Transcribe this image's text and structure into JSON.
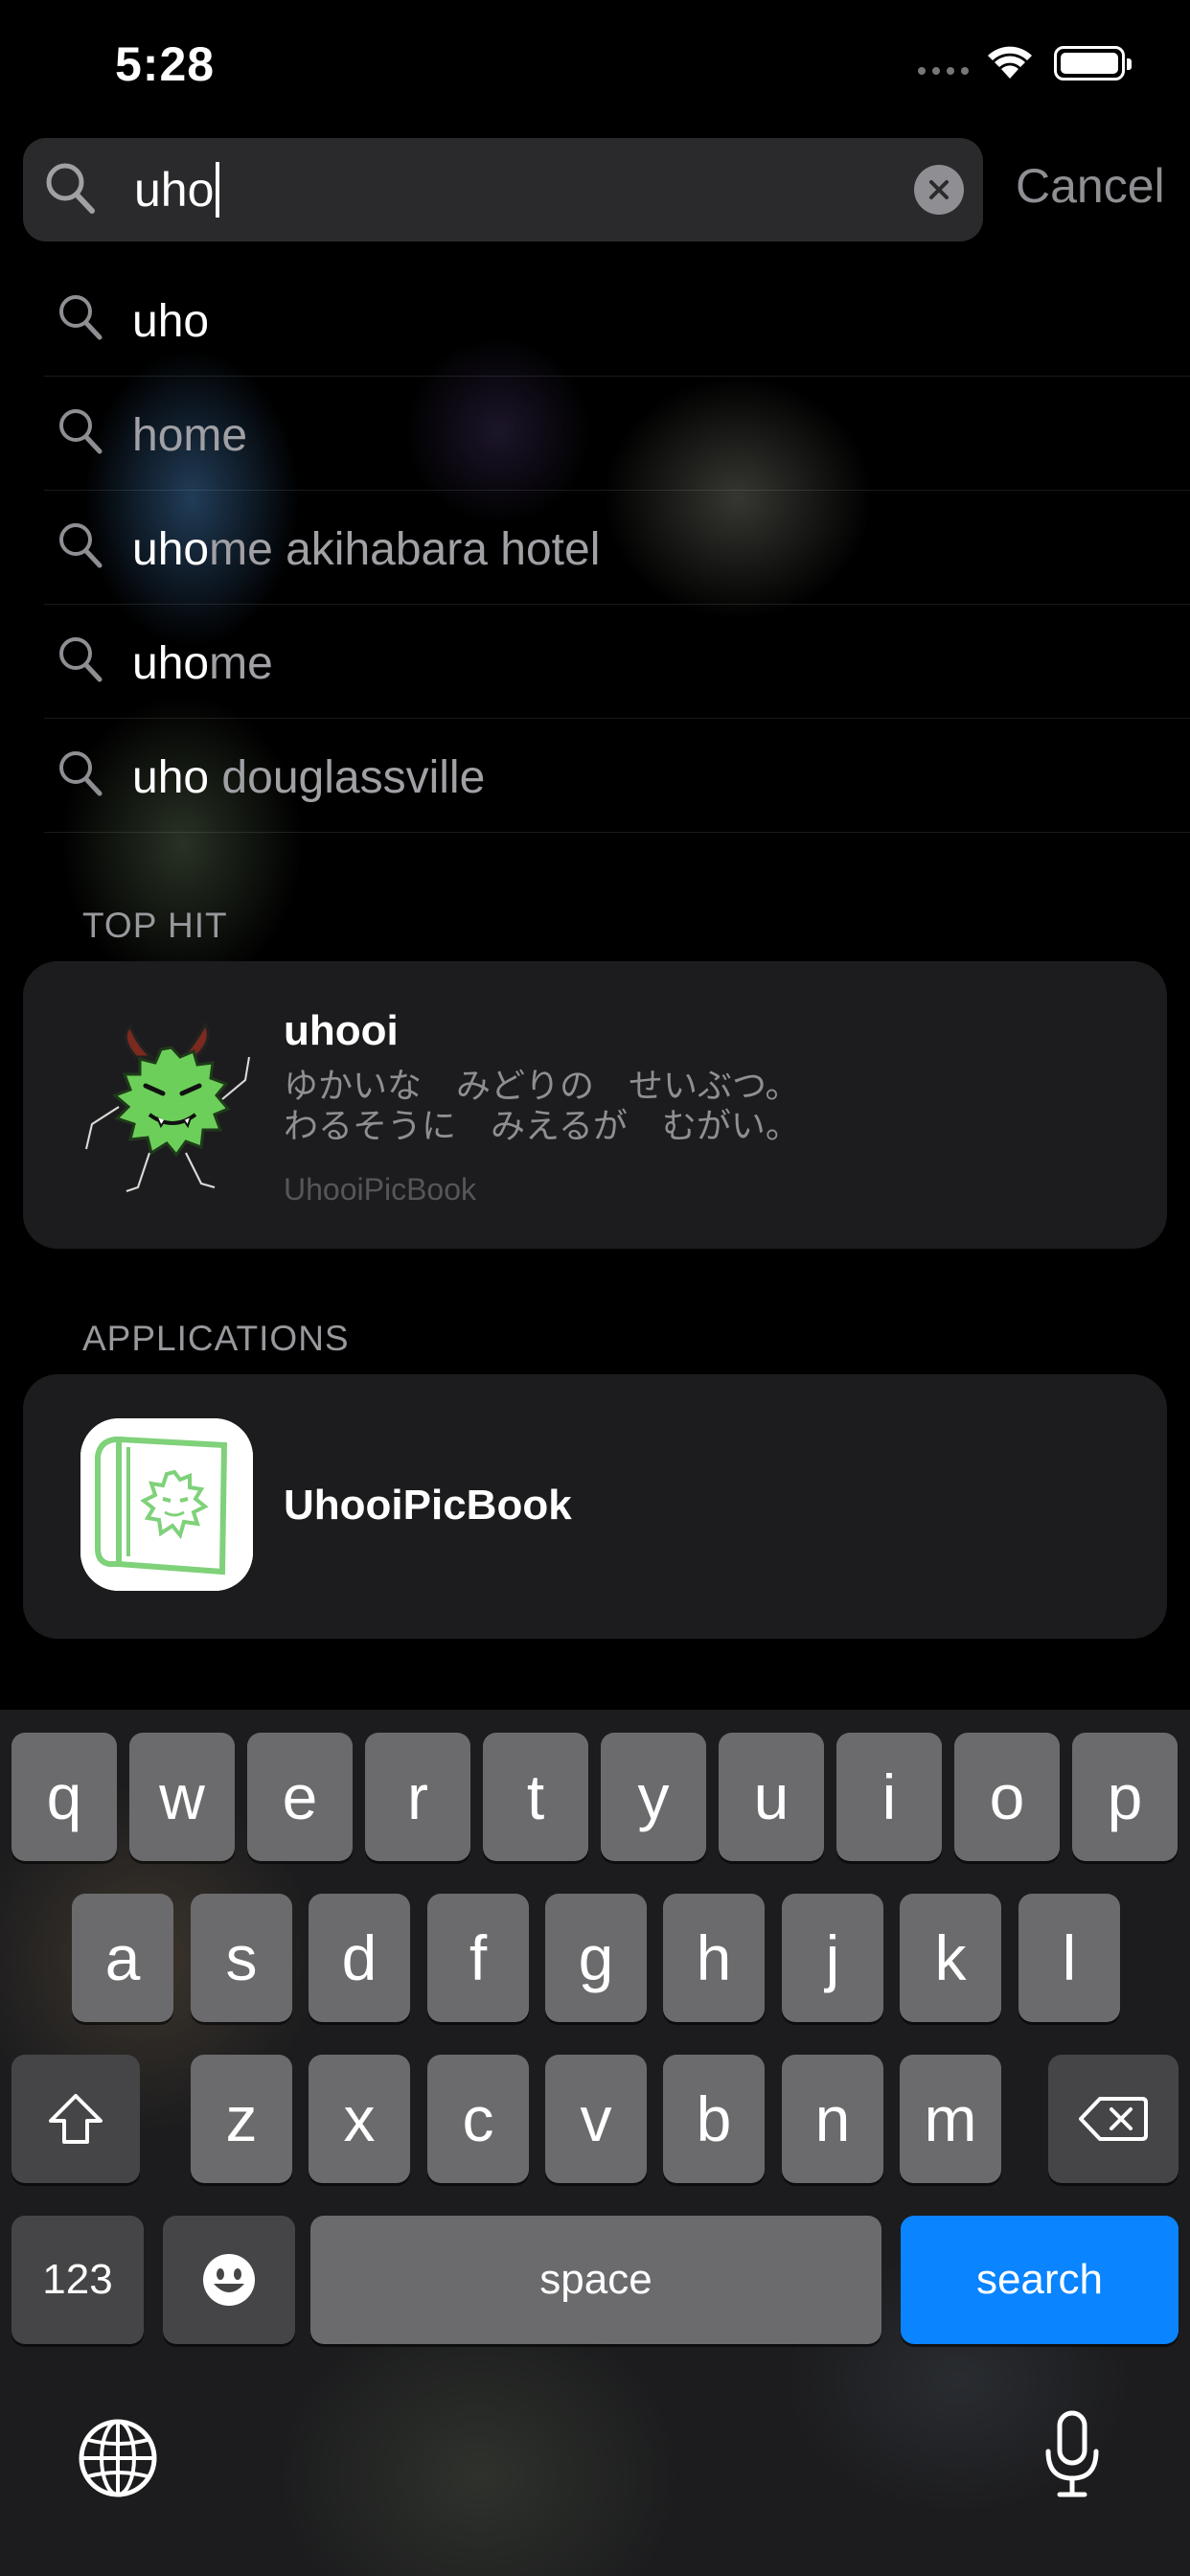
{
  "status_bar": {
    "time": "5:28"
  },
  "search": {
    "query": "uho",
    "cancel_label": "Cancel"
  },
  "suggestions": [
    {
      "highlight": "uho",
      "rest": ""
    },
    {
      "highlight": "",
      "rest": "home"
    },
    {
      "highlight": "uho",
      "rest": "me akihabara hotel"
    },
    {
      "highlight": "uho",
      "rest": "me"
    },
    {
      "highlight": "uho",
      "rest": " douglassville"
    }
  ],
  "top_hit": {
    "header": "TOP HIT",
    "title": "uhooi",
    "description_line1": "ゆかいな　みどりの　せいぶつ。",
    "description_line2": "わるそうに　みえるが　むがい。",
    "source": "UhooiPicBook"
  },
  "applications": {
    "header": "APPLICATIONS",
    "app_name": "UhooiPicBook"
  },
  "keyboard": {
    "row1": [
      "q",
      "w",
      "e",
      "r",
      "t",
      "y",
      "u",
      "i",
      "o",
      "p"
    ],
    "row2": [
      "a",
      "s",
      "d",
      "f",
      "g",
      "h",
      "j",
      "k",
      "l"
    ],
    "row3": [
      "z",
      "x",
      "c",
      "v",
      "b",
      "n",
      "m"
    ],
    "numbers_label": "123",
    "space_label": "space",
    "search_label": "search"
  },
  "colors": {
    "accent": "#0a84ff",
    "background": "#000000",
    "card": "#1e1e20",
    "secondary_text": "#8e8e93"
  },
  "icons": [
    "search-icon",
    "clear-icon",
    "shift-icon",
    "backspace-icon",
    "emoji-icon",
    "globe-icon",
    "microphone-icon",
    "wifi-icon",
    "battery-icon"
  ]
}
